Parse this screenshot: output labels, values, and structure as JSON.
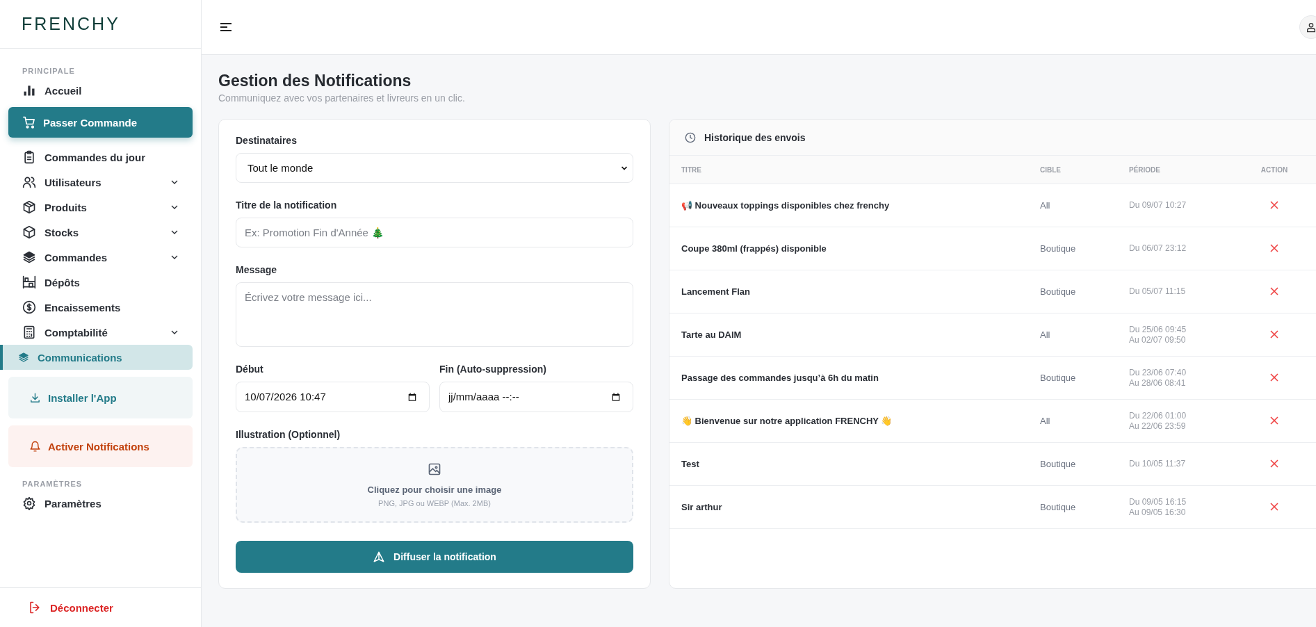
{
  "brand": "FRENCHY",
  "sidebar": {
    "sections": [
      {
        "heading": "PRINCIPALE",
        "items": [
          {
            "label": "Accueil",
            "kind": "link",
            "expandable": false,
            "selected": false
          },
          {
            "label": "Passer Commande",
            "kind": "primary",
            "expandable": false,
            "selected": false
          },
          {
            "label": "Commandes du jour",
            "kind": "link",
            "expandable": false,
            "selected": false
          },
          {
            "label": "Utilisateurs",
            "kind": "link",
            "expandable": true,
            "selected": false
          },
          {
            "label": "Produits",
            "kind": "link",
            "expandable": true,
            "selected": false
          },
          {
            "label": "Stocks",
            "kind": "link",
            "expandable": true,
            "selected": false
          },
          {
            "label": "Commandes",
            "kind": "link",
            "expandable": true,
            "selected": false
          },
          {
            "label": "Dépôts",
            "kind": "link",
            "expandable": false,
            "selected": false
          },
          {
            "label": "Encaissements",
            "kind": "link",
            "expandable": false,
            "selected": false
          },
          {
            "label": "Comptabilité",
            "kind": "link",
            "expandable": true,
            "selected": false
          },
          {
            "label": "Communications",
            "kind": "link",
            "expandable": false,
            "selected": true
          },
          {
            "label": "Installer l'App",
            "kind": "install",
            "expandable": false,
            "selected": false
          },
          {
            "label": "Activer Notifications",
            "kind": "alert",
            "expandable": false,
            "selected": false
          }
        ]
      },
      {
        "heading": "PARAMÈTRES",
        "items": [
          {
            "label": "Paramètres",
            "kind": "link",
            "expandable": false,
            "selected": false
          }
        ]
      }
    ],
    "logout": "Déconnecter"
  },
  "page": {
    "title": "Gestion des Notifications",
    "subtitle": "Communiquez avec vos partenaires et livreurs en un clic."
  },
  "form": {
    "recipients": {
      "label": "Destinataires",
      "value": "Tout le monde"
    },
    "title": {
      "label": "Titre de la notification",
      "placeholder": "Ex: Promotion Fin d'Année 🎄"
    },
    "message": {
      "label": "Message",
      "placeholder": "Écrivez votre message ici..."
    },
    "start": {
      "label": "Début",
      "value": "10/07/2026 10:47"
    },
    "end": {
      "label": "Fin (Auto-suppression)",
      "placeholder": "jj/mm/aaaa --:--"
    },
    "illustration": {
      "label": "Illustration (Optionnel)",
      "prompt": "Cliquez pour choisir une image",
      "hint": "PNG, JPG ou WEBP (Max. 2MB)"
    },
    "submit": "Diffuser la notification"
  },
  "history": {
    "title": "Historique des envois",
    "columns": [
      "TITRE",
      "CIBLE",
      "PÉRIODE",
      "ACTION"
    ],
    "rows": [
      {
        "title": "📢 Nouveaux toppings disponibles chez frenchy",
        "target": "All",
        "period": [
          "Du 09/07 10:27"
        ]
      },
      {
        "title": "Coupe 380ml (frappés) disponible",
        "target": "Boutique",
        "period": [
          "Du 06/07 23:12"
        ]
      },
      {
        "title": "Lancement Flan",
        "target": "Boutique",
        "period": [
          "Du 05/07 11:15"
        ]
      },
      {
        "title": "Tarte au DAIM",
        "target": "All",
        "period": [
          "Du 25/06 09:45",
          "Au 02/07 09:50"
        ]
      },
      {
        "title": "Passage des commandes jusqu’à 6h du matin",
        "target": "Boutique",
        "period": [
          "Du 23/06 07:40",
          "Au 28/06 08:41"
        ]
      },
      {
        "title": "👋 Bienvenue sur notre application FRENCHY 👋",
        "target": "All",
        "period": [
          "Du 22/06 01:00",
          "Au 22/06 23:59"
        ]
      },
      {
        "title": "Test",
        "target": "Boutique",
        "period": [
          "Du 10/05 11:37"
        ]
      },
      {
        "title": "Sir arthur",
        "target": "Boutique",
        "period": [
          "Du 09/05 16:15",
          "Au 09/05 16:30"
        ]
      }
    ]
  }
}
